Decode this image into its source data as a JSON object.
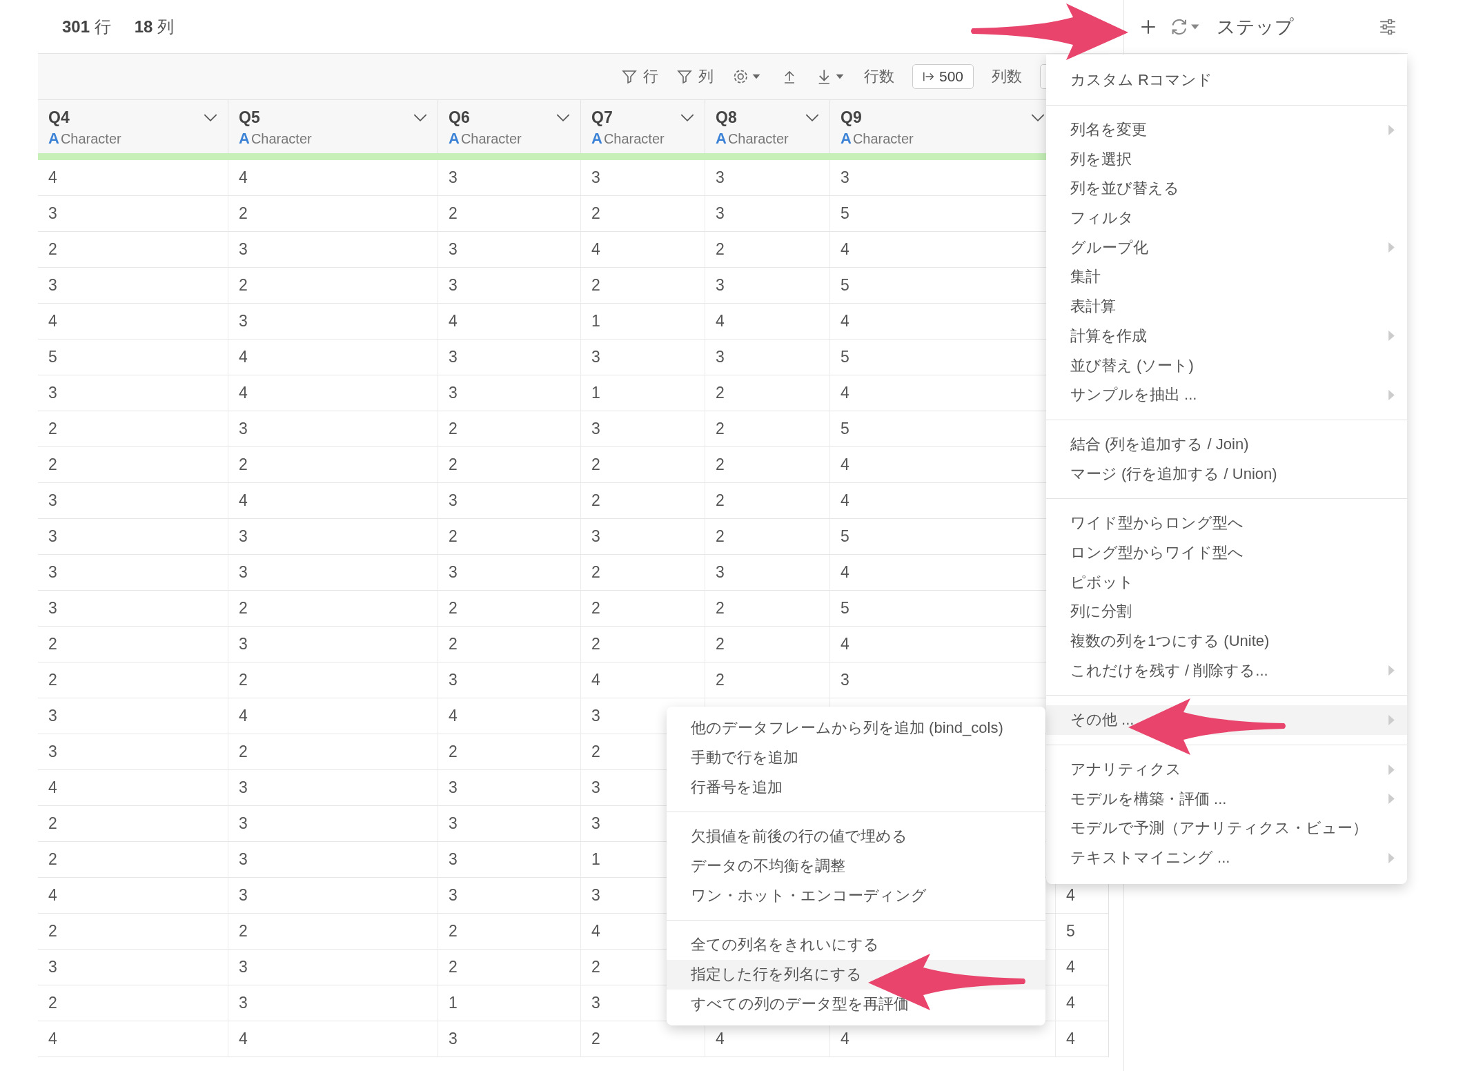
{
  "summary": [
    "**301** 行",
    "**18** 列"
  ],
  "steps_panel": {
    "title": "ステップ"
  },
  "toolbar": {
    "row_filter": "行",
    "column_filter": "列",
    "rows_label": "行数",
    "rows_value": "500",
    "columns_label": "列数"
  },
  "table": {
    "columns": [
      {
        "name": "Q4",
        "type_icon": "A",
        "type": "Character"
      },
      {
        "name": "Q5",
        "type_icon": "A",
        "type": "Character"
      },
      {
        "name": "Q6",
        "type_icon": "A",
        "type": "Character"
      },
      {
        "name": "Q7",
        "type_icon": "A",
        "type": "Character"
      },
      {
        "name": "Q8",
        "type_icon": "A",
        "type": "Character"
      },
      {
        "name": "Q9",
        "type_icon": "A",
        "type": "Character"
      }
    ],
    "rows": [
      [
        "4",
        "4",
        "3",
        "3",
        "3",
        "3",
        null
      ],
      [
        "3",
        "2",
        "2",
        "2",
        "3",
        "5",
        null
      ],
      [
        "2",
        "3",
        "3",
        "4",
        "2",
        "4",
        null
      ],
      [
        "3",
        "2",
        "3",
        "2",
        "3",
        "5",
        null
      ],
      [
        "4",
        "3",
        "4",
        "1",
        "4",
        "4",
        null
      ],
      [
        "5",
        "4",
        "3",
        "3",
        "3",
        "5",
        null
      ],
      [
        "3",
        "4",
        "3",
        "1",
        "2",
        "4",
        null
      ],
      [
        "2",
        "3",
        "2",
        "3",
        "2",
        "5",
        null
      ],
      [
        "2",
        "2",
        "2",
        "2",
        "2",
        "4",
        null
      ],
      [
        "3",
        "4",
        "3",
        "2",
        "2",
        "4",
        null
      ],
      [
        "3",
        "3",
        "2",
        "3",
        "2",
        "5",
        null
      ],
      [
        "3",
        "3",
        "3",
        "2",
        "3",
        "4",
        null
      ],
      [
        "3",
        "2",
        "2",
        "2",
        "2",
        "5",
        null
      ],
      [
        "2",
        "3",
        "2",
        "2",
        "2",
        "4",
        null
      ],
      [
        "2",
        "2",
        "3",
        "4",
        "2",
        "3",
        null
      ],
      [
        "3",
        "4",
        "4",
        "3",
        null,
        null,
        null
      ],
      [
        "3",
        "2",
        "2",
        "2",
        null,
        null,
        null
      ],
      [
        "4",
        "3",
        "3",
        "3",
        null,
        null,
        null
      ],
      [
        "2",
        "3",
        "3",
        "3",
        null,
        null,
        null
      ],
      [
        "2",
        "3",
        "3",
        "1",
        null,
        null,
        null
      ],
      [
        "4",
        "3",
        "3",
        "3",
        null,
        null,
        "4"
      ],
      [
        "2",
        "2",
        "2",
        "4",
        null,
        null,
        "5"
      ],
      [
        "3",
        "3",
        "2",
        "2",
        null,
        null,
        "4"
      ],
      [
        "2",
        "3",
        "1",
        "3",
        null,
        null,
        "4"
      ],
      [
        "4",
        "4",
        "3",
        "2",
        "4",
        "4",
        "4"
      ]
    ]
  },
  "menu": {
    "items": [
      {
        "kind": "item",
        "label": "カスタム Rコマンド",
        "submenu": false,
        "selected": false
      },
      {
        "kind": "separator"
      },
      {
        "kind": "item",
        "label": "列名を変更",
        "submenu": true,
        "selected": false
      },
      {
        "kind": "item",
        "label": "列を選択",
        "submenu": false,
        "selected": false
      },
      {
        "kind": "item",
        "label": "列を並び替える",
        "submenu": false,
        "selected": false
      },
      {
        "kind": "item",
        "label": "フィルタ",
        "submenu": false,
        "selected": false
      },
      {
        "kind": "item",
        "label": "グループ化",
        "submenu": true,
        "selected": false
      },
      {
        "kind": "item",
        "label": "集計",
        "submenu": false,
        "selected": false
      },
      {
        "kind": "item",
        "label": "表計算",
        "submenu": false,
        "selected": false
      },
      {
        "kind": "item",
        "label": "計算を作成",
        "submenu": true,
        "selected": false
      },
      {
        "kind": "item",
        "label": "並び替え (ソート)",
        "submenu": false,
        "selected": false
      },
      {
        "kind": "item",
        "label": "サンプルを抽出 ...",
        "submenu": true,
        "selected": false
      },
      {
        "kind": "separator"
      },
      {
        "kind": "item",
        "label": "結合 (列を追加する / Join)",
        "submenu": false,
        "selected": false
      },
      {
        "kind": "item",
        "label": "マージ (行を追加する / Union)",
        "submenu": false,
        "selected": false
      },
      {
        "kind": "separator"
      },
      {
        "kind": "item",
        "label": "ワイド型からロング型へ",
        "submenu": false,
        "selected": false
      },
      {
        "kind": "item",
        "label": "ロング型からワイド型へ",
        "submenu": false,
        "selected": false
      },
      {
        "kind": "item",
        "label": "ピボット",
        "submenu": false,
        "selected": false
      },
      {
        "kind": "item",
        "label": "列に分割",
        "submenu": false,
        "selected": false
      },
      {
        "kind": "item",
        "label": "複数の列を1つにする (Unite)",
        "submenu": false,
        "selected": false
      },
      {
        "kind": "item",
        "label": "これだけを残す / 削除する...",
        "submenu": true,
        "selected": false
      },
      {
        "kind": "separator"
      },
      {
        "kind": "item",
        "label": "その他 ...",
        "submenu": true,
        "selected": true
      },
      {
        "kind": "separator"
      },
      {
        "kind": "item",
        "label": "アナリティクス",
        "submenu": true,
        "selected": false
      },
      {
        "kind": "item",
        "label": "モデルを構築・評価 ...",
        "submenu": true,
        "selected": false
      },
      {
        "kind": "item",
        "label": "モデルで予測（アナリティクス・ビュー）",
        "submenu": false,
        "selected": false
      },
      {
        "kind": "item",
        "label": "テキストマイニング ...",
        "submenu": true,
        "selected": false
      }
    ]
  },
  "submenu": {
    "items": [
      {
        "kind": "item",
        "label": "他のデータフレームから列を追加 (bind_cols)",
        "selected": false
      },
      {
        "kind": "item",
        "label": "手動で行を追加",
        "selected": false
      },
      {
        "kind": "item",
        "label": "行番号を追加",
        "selected": false
      },
      {
        "kind": "separator"
      },
      {
        "kind": "item",
        "label": "欠損値を前後の行の値で埋める",
        "selected": false
      },
      {
        "kind": "item",
        "label": "データの不均衡を調整",
        "selected": false
      },
      {
        "kind": "item",
        "label": "ワン・ホット・エンコーディング",
        "selected": false
      },
      {
        "kind": "separator"
      },
      {
        "kind": "item",
        "label": "全ての列名をきれいにする",
        "selected": false
      },
      {
        "kind": "item",
        "label": "指定した行を列名にする",
        "selected": true
      },
      {
        "kind": "item",
        "label": "すべての列のデータ型を再評価",
        "selected": false
      }
    ]
  }
}
